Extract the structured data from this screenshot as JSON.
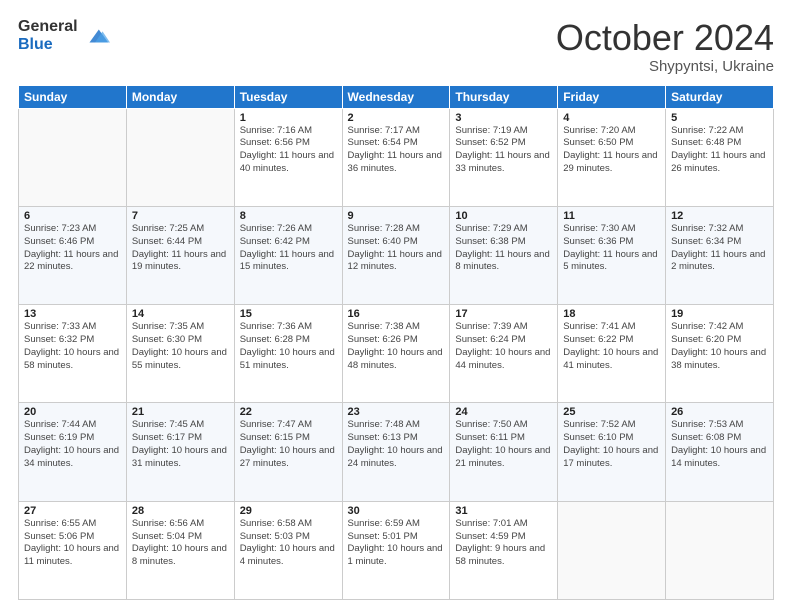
{
  "header": {
    "logo_general": "General",
    "logo_blue": "Blue",
    "month": "October 2024",
    "location": "Shypyntsi, Ukraine"
  },
  "weekdays": [
    "Sunday",
    "Monday",
    "Tuesday",
    "Wednesday",
    "Thursday",
    "Friday",
    "Saturday"
  ],
  "weeks": [
    [
      {
        "day": "",
        "sunrise": "",
        "sunset": "",
        "daylight": ""
      },
      {
        "day": "",
        "sunrise": "",
        "sunset": "",
        "daylight": ""
      },
      {
        "day": "1",
        "sunrise": "Sunrise: 7:16 AM",
        "sunset": "Sunset: 6:56 PM",
        "daylight": "Daylight: 11 hours and 40 minutes."
      },
      {
        "day": "2",
        "sunrise": "Sunrise: 7:17 AM",
        "sunset": "Sunset: 6:54 PM",
        "daylight": "Daylight: 11 hours and 36 minutes."
      },
      {
        "day": "3",
        "sunrise": "Sunrise: 7:19 AM",
        "sunset": "Sunset: 6:52 PM",
        "daylight": "Daylight: 11 hours and 33 minutes."
      },
      {
        "day": "4",
        "sunrise": "Sunrise: 7:20 AM",
        "sunset": "Sunset: 6:50 PM",
        "daylight": "Daylight: 11 hours and 29 minutes."
      },
      {
        "day": "5",
        "sunrise": "Sunrise: 7:22 AM",
        "sunset": "Sunset: 6:48 PM",
        "daylight": "Daylight: 11 hours and 26 minutes."
      }
    ],
    [
      {
        "day": "6",
        "sunrise": "Sunrise: 7:23 AM",
        "sunset": "Sunset: 6:46 PM",
        "daylight": "Daylight: 11 hours and 22 minutes."
      },
      {
        "day": "7",
        "sunrise": "Sunrise: 7:25 AM",
        "sunset": "Sunset: 6:44 PM",
        "daylight": "Daylight: 11 hours and 19 minutes."
      },
      {
        "day": "8",
        "sunrise": "Sunrise: 7:26 AM",
        "sunset": "Sunset: 6:42 PM",
        "daylight": "Daylight: 11 hours and 15 minutes."
      },
      {
        "day": "9",
        "sunrise": "Sunrise: 7:28 AM",
        "sunset": "Sunset: 6:40 PM",
        "daylight": "Daylight: 11 hours and 12 minutes."
      },
      {
        "day": "10",
        "sunrise": "Sunrise: 7:29 AM",
        "sunset": "Sunset: 6:38 PM",
        "daylight": "Daylight: 11 hours and 8 minutes."
      },
      {
        "day": "11",
        "sunrise": "Sunrise: 7:30 AM",
        "sunset": "Sunset: 6:36 PM",
        "daylight": "Daylight: 11 hours and 5 minutes."
      },
      {
        "day": "12",
        "sunrise": "Sunrise: 7:32 AM",
        "sunset": "Sunset: 6:34 PM",
        "daylight": "Daylight: 11 hours and 2 minutes."
      }
    ],
    [
      {
        "day": "13",
        "sunrise": "Sunrise: 7:33 AM",
        "sunset": "Sunset: 6:32 PM",
        "daylight": "Daylight: 10 hours and 58 minutes."
      },
      {
        "day": "14",
        "sunrise": "Sunrise: 7:35 AM",
        "sunset": "Sunset: 6:30 PM",
        "daylight": "Daylight: 10 hours and 55 minutes."
      },
      {
        "day": "15",
        "sunrise": "Sunrise: 7:36 AM",
        "sunset": "Sunset: 6:28 PM",
        "daylight": "Daylight: 10 hours and 51 minutes."
      },
      {
        "day": "16",
        "sunrise": "Sunrise: 7:38 AM",
        "sunset": "Sunset: 6:26 PM",
        "daylight": "Daylight: 10 hours and 48 minutes."
      },
      {
        "day": "17",
        "sunrise": "Sunrise: 7:39 AM",
        "sunset": "Sunset: 6:24 PM",
        "daylight": "Daylight: 10 hours and 44 minutes."
      },
      {
        "day": "18",
        "sunrise": "Sunrise: 7:41 AM",
        "sunset": "Sunset: 6:22 PM",
        "daylight": "Daylight: 10 hours and 41 minutes."
      },
      {
        "day": "19",
        "sunrise": "Sunrise: 7:42 AM",
        "sunset": "Sunset: 6:20 PM",
        "daylight": "Daylight: 10 hours and 38 minutes."
      }
    ],
    [
      {
        "day": "20",
        "sunrise": "Sunrise: 7:44 AM",
        "sunset": "Sunset: 6:19 PM",
        "daylight": "Daylight: 10 hours and 34 minutes."
      },
      {
        "day": "21",
        "sunrise": "Sunrise: 7:45 AM",
        "sunset": "Sunset: 6:17 PM",
        "daylight": "Daylight: 10 hours and 31 minutes."
      },
      {
        "day": "22",
        "sunrise": "Sunrise: 7:47 AM",
        "sunset": "Sunset: 6:15 PM",
        "daylight": "Daylight: 10 hours and 27 minutes."
      },
      {
        "day": "23",
        "sunrise": "Sunrise: 7:48 AM",
        "sunset": "Sunset: 6:13 PM",
        "daylight": "Daylight: 10 hours and 24 minutes."
      },
      {
        "day": "24",
        "sunrise": "Sunrise: 7:50 AM",
        "sunset": "Sunset: 6:11 PM",
        "daylight": "Daylight: 10 hours and 21 minutes."
      },
      {
        "day": "25",
        "sunrise": "Sunrise: 7:52 AM",
        "sunset": "Sunset: 6:10 PM",
        "daylight": "Daylight: 10 hours and 17 minutes."
      },
      {
        "day": "26",
        "sunrise": "Sunrise: 7:53 AM",
        "sunset": "Sunset: 6:08 PM",
        "daylight": "Daylight: 10 hours and 14 minutes."
      }
    ],
    [
      {
        "day": "27",
        "sunrise": "Sunrise: 6:55 AM",
        "sunset": "Sunset: 5:06 PM",
        "daylight": "Daylight: 10 hours and 11 minutes."
      },
      {
        "day": "28",
        "sunrise": "Sunrise: 6:56 AM",
        "sunset": "Sunset: 5:04 PM",
        "daylight": "Daylight: 10 hours and 8 minutes."
      },
      {
        "day": "29",
        "sunrise": "Sunrise: 6:58 AM",
        "sunset": "Sunset: 5:03 PM",
        "daylight": "Daylight: 10 hours and 4 minutes."
      },
      {
        "day": "30",
        "sunrise": "Sunrise: 6:59 AM",
        "sunset": "Sunset: 5:01 PM",
        "daylight": "Daylight: 10 hours and 1 minute."
      },
      {
        "day": "31",
        "sunrise": "Sunrise: 7:01 AM",
        "sunset": "Sunset: 4:59 PM",
        "daylight": "Daylight: 9 hours and 58 minutes."
      },
      {
        "day": "",
        "sunrise": "",
        "sunset": "",
        "daylight": ""
      },
      {
        "day": "",
        "sunrise": "",
        "sunset": "",
        "daylight": ""
      }
    ]
  ]
}
